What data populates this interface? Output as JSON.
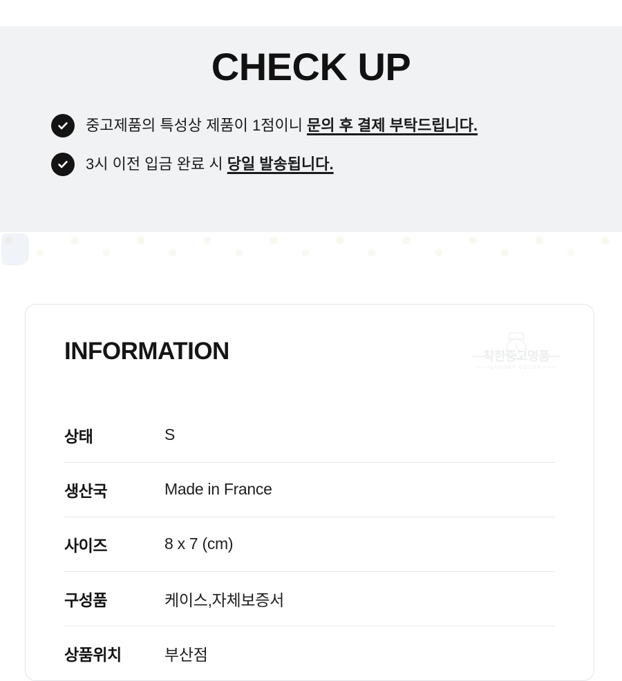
{
  "checkup": {
    "title": "CHECK UP",
    "items": [
      {
        "icon": "check-circle-icon",
        "plain": "중고제품의 특성상 제품이 1점이니 ",
        "emphasis": "문의 후 결제 부탁드립니다."
      },
      {
        "icon": "check-circle-icon",
        "plain": "3시 이전 입금 완료 시 ",
        "emphasis": "당일 발송됩니다."
      }
    ]
  },
  "information": {
    "title": "INFORMATION",
    "watermark": {
      "brand": "착한중고명품",
      "tagline": "LUXURY GOODS",
      "icon": "watch-icon"
    },
    "rows": [
      {
        "label": "상태",
        "value": "S"
      },
      {
        "label": "생산국",
        "value": "Made in France"
      },
      {
        "label": "사이즈",
        "value": "8 x 7 (cm)"
      },
      {
        "label": "구성품",
        "value": "케이스,자체보증서"
      },
      {
        "label": "상품위치",
        "value": "부산점"
      }
    ]
  },
  "colors": {
    "band_background": "#f1f2f4",
    "page_background": "#ffffff",
    "text_primary": "#111111",
    "icon_fill": "#141414",
    "divider": "#e6e7e9",
    "card_border": "#e3e4e6",
    "watermark": "#edeeef"
  }
}
